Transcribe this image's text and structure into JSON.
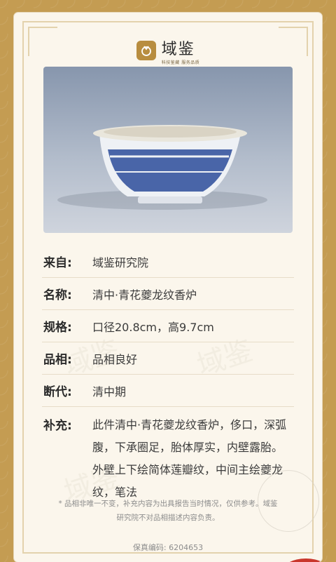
{
  "header": {
    "brand": "域鉴",
    "brand_sub": "科技鉴藏 服务品质",
    "logo_icon": "seal-logo-icon"
  },
  "item": {
    "rows": [
      {
        "label": "来自:",
        "value": "域鉴研究院"
      },
      {
        "label": "名称:",
        "value": "清中·青花夔龙纹香炉"
      },
      {
        "label": "规格:",
        "value": "口径20.8cm，高9.7cm"
      },
      {
        "label": "品相:",
        "value": "品相良好"
      },
      {
        "label": "断代:",
        "value": "清中期"
      }
    ],
    "desc_label": "补充:",
    "desc_text": "此件清中·青花夔龙纹香炉，侈口，深弧腹，下承圈足，胎体厚实，内壁露胎。外壁上下绘简体莲瓣纹，中间主绘夔龙纹，笔法"
  },
  "note": "* 品相非唯一不变，补充内容为出具报告当时情况，仅供参考。域鉴研究院不对品相描述内容负责。",
  "code": "保真编码: 6204653",
  "colors": {
    "accent": "#b88d3f",
    "stamp": "#c9362c"
  }
}
